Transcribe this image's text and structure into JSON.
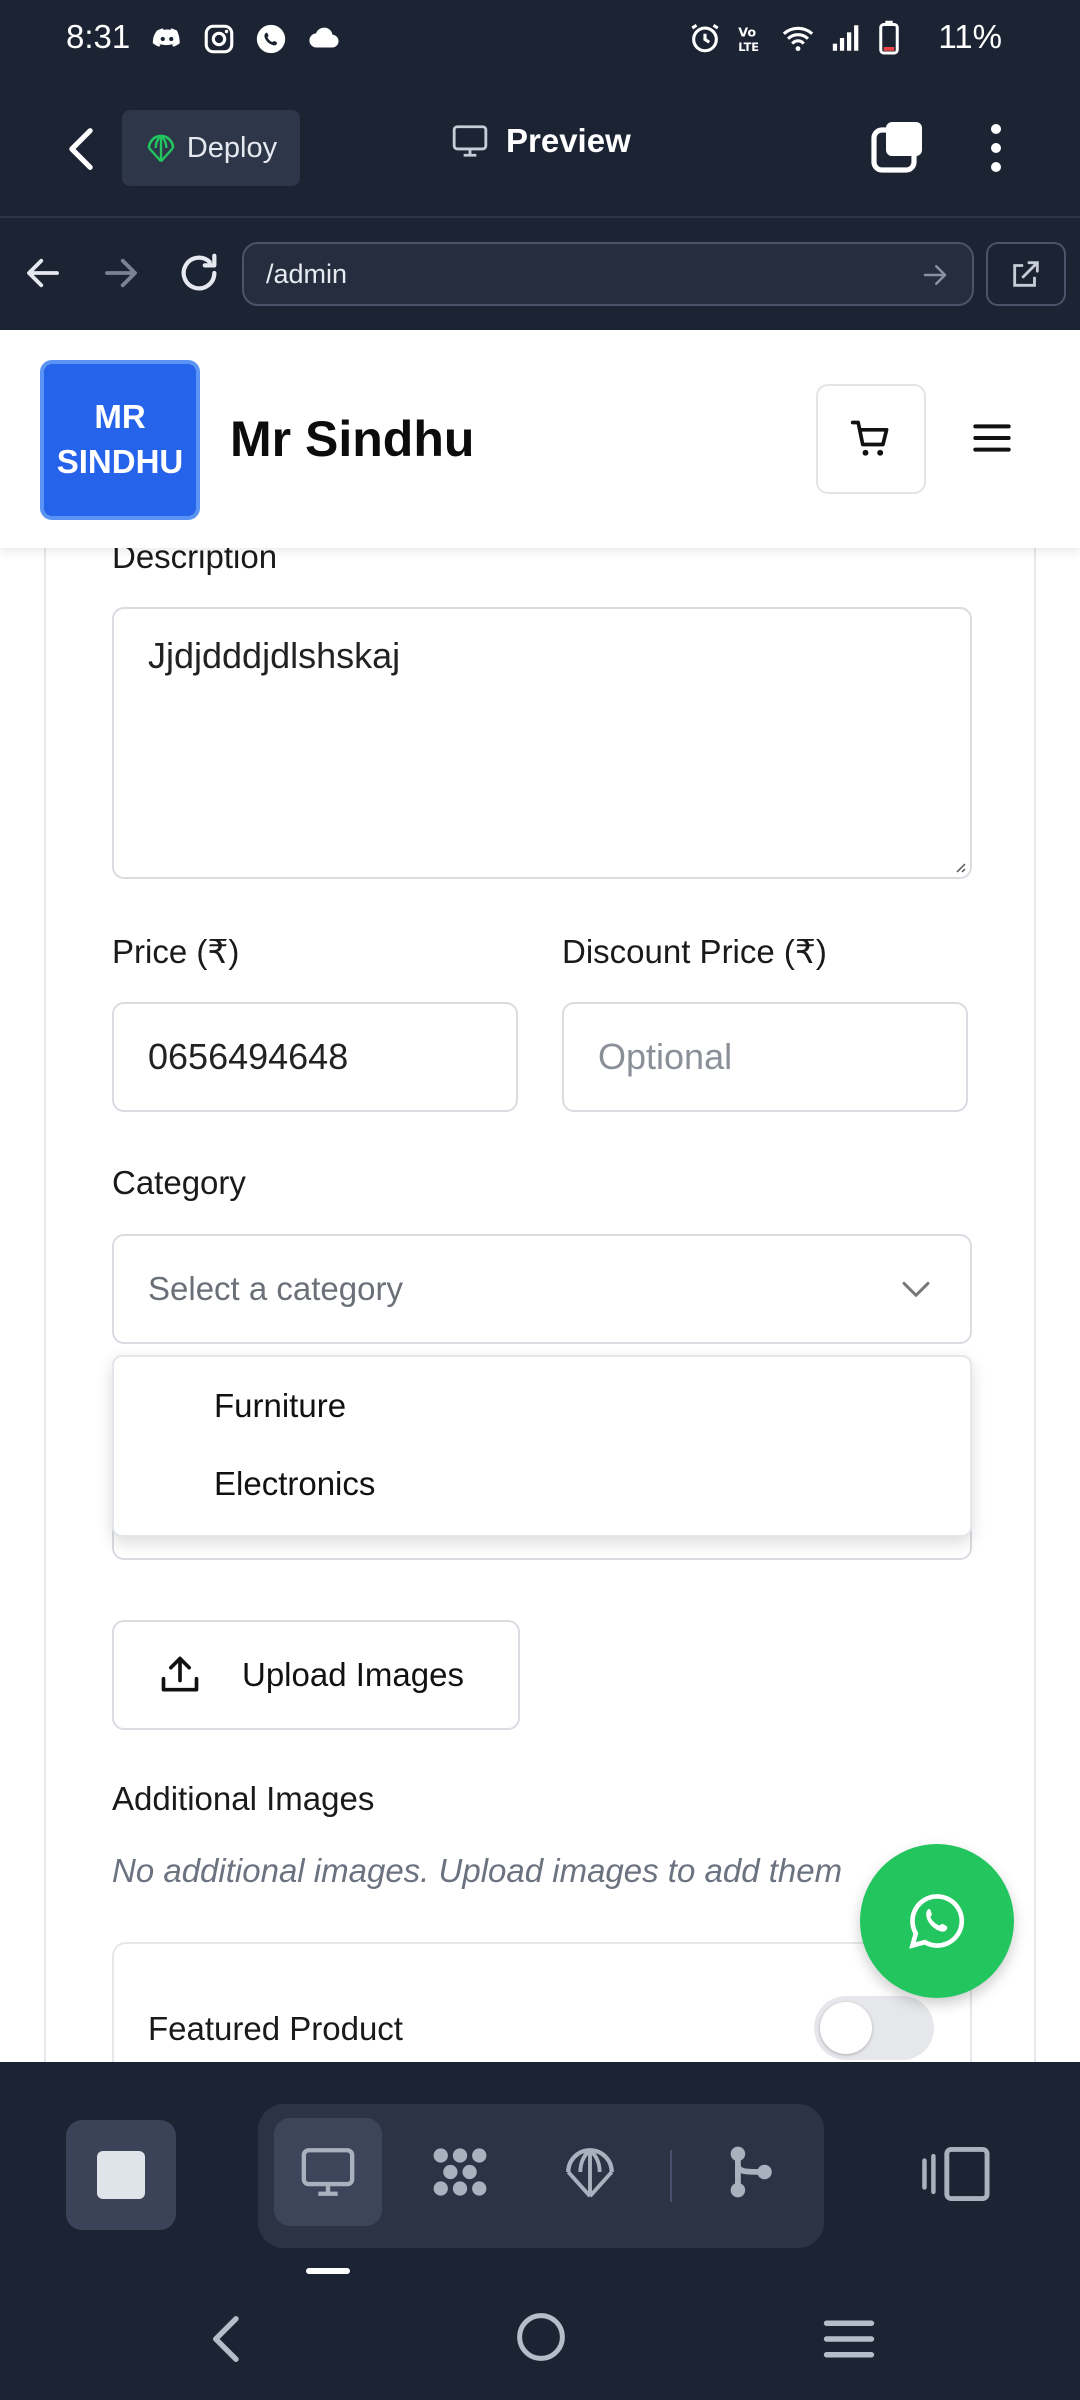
{
  "status_bar": {
    "time": "8:31",
    "battery": "11%"
  },
  "top_bar": {
    "deploy_label": "Deploy",
    "preview_label": "Preview"
  },
  "url_bar": {
    "url": "/admin"
  },
  "site": {
    "logo_line1": "MR",
    "logo_line2": "SINDHU",
    "brand": "Mr Sindhu"
  },
  "form": {
    "description_label": "Description",
    "description_value": "Jjdjdddjdlshskaj",
    "price_label": "Price (₹)",
    "price_value": "0656494648",
    "discount_label": "Discount Price (₹)",
    "discount_placeholder": "Optional",
    "category_label": "Category",
    "category_placeholder": "Select a category",
    "category_options": [
      "Furniture",
      "Electronics"
    ],
    "upload_label": "Upload Images",
    "additional_label": "Additional Images",
    "additional_hint": "No additional images. Upload images to add them",
    "featured_label": "Featured Product"
  },
  "colors": {
    "brand_blue": "#2563eb",
    "whatsapp_green": "#22c55e",
    "app_bg": "#1c2333"
  }
}
